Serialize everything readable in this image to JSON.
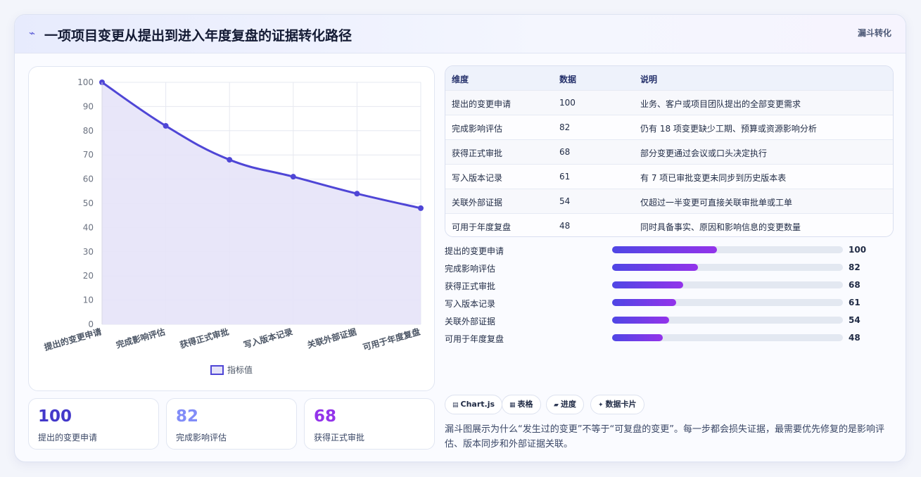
{
  "header": {
    "title": "一项项目变更从提出到进入年度复盘的证据转化路径",
    "tag": "漏斗转化"
  },
  "chart_data": {
    "type": "line",
    "categories": [
      "提出的变更申请",
      "完成影响评估",
      "获得正式审批",
      "写入版本记录",
      "关联外部证据",
      "可用于年度复盘"
    ],
    "series": [
      {
        "name": "指标值",
        "values": [
          100,
          82,
          68,
          61,
          54,
          48
        ]
      }
    ],
    "ylim": [
      0,
      100
    ],
    "yticks": [
      0,
      10,
      20,
      30,
      40,
      50,
      60,
      70,
      80,
      90,
      100
    ],
    "fill": true,
    "grid": true,
    "legend": "bottom",
    "colors": {
      "line": "#4f46d6",
      "fill": "#e5e3f8"
    }
  },
  "stats": [
    {
      "value": "100",
      "label": "提出的变更申请",
      "color": "#4338ca"
    },
    {
      "value": "82",
      "label": "完成影响评估",
      "color": "#818cf8"
    },
    {
      "value": "68",
      "label": "获得正式审批",
      "color": "#9333ea"
    }
  ],
  "table": {
    "headers": [
      "维度",
      "数据",
      "说明"
    ],
    "rows": [
      [
        "提出的变更申请",
        "100",
        "业务、客户或项目团队提出的全部变更需求"
      ],
      [
        "完成影响评估",
        "82",
        "仍有 18 项变更缺少工期、预算或资源影响分析"
      ],
      [
        "获得正式审批",
        "68",
        "部分变更通过会议或口头决定执行"
      ],
      [
        "写入版本记录",
        "61",
        "有 7 项已审批变更未同步到历史版本表"
      ],
      [
        "关联外部证据",
        "54",
        "仅超过一半变更可直接关联审批单或工单"
      ],
      [
        "可用于年度复盘",
        "48",
        "同时具备事实、原因和影响信息的变更数量"
      ]
    ]
  },
  "progress": {
    "max": 220,
    "items": [
      {
        "label": "提出的变更申请",
        "value": 100
      },
      {
        "label": "完成影响评估",
        "value": 82
      },
      {
        "label": "获得正式审批",
        "value": 68
      },
      {
        "label": "写入版本记录",
        "value": 61
      },
      {
        "label": "关联外部证据",
        "value": 54
      },
      {
        "label": "可用于年度复盘",
        "value": 48
      }
    ]
  },
  "chips": [
    {
      "icon": "chart-icon",
      "label": "Chart.js"
    },
    {
      "icon": "table-icon",
      "label": "表格"
    },
    {
      "icon": "progress-icon",
      "label": "进度"
    },
    {
      "icon": "sparkle-icon",
      "label": "数据卡片"
    }
  ],
  "description": "漏斗图展示为什么“发生过的变更”不等于“可复盘的变更”。每一步都会损失证据，最需要优先修复的是影响评估、版本同步和外部证据关联。"
}
